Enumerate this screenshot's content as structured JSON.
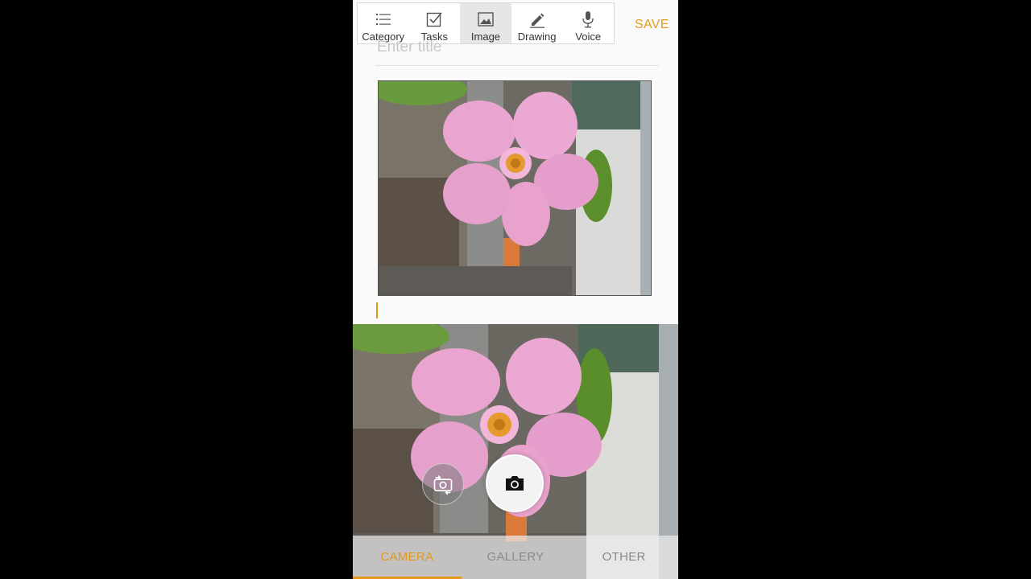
{
  "toolbar": {
    "items": [
      {
        "label": "Category",
        "icon": "list-icon"
      },
      {
        "label": "Tasks",
        "icon": "checkbox-icon"
      },
      {
        "label": "Image",
        "icon": "image-icon",
        "active": true
      },
      {
        "label": "Drawing",
        "icon": "pencil-icon"
      },
      {
        "label": "Voice",
        "icon": "microphone-icon"
      }
    ],
    "save_label": "SAVE"
  },
  "note": {
    "title_placeholder": "Enter title"
  },
  "camera": {
    "tabs": [
      {
        "label": "CAMERA",
        "active": true
      },
      {
        "label": "GALLERY"
      },
      {
        "label": "OTHER"
      }
    ]
  },
  "colors": {
    "accent": "#e19a1c"
  }
}
